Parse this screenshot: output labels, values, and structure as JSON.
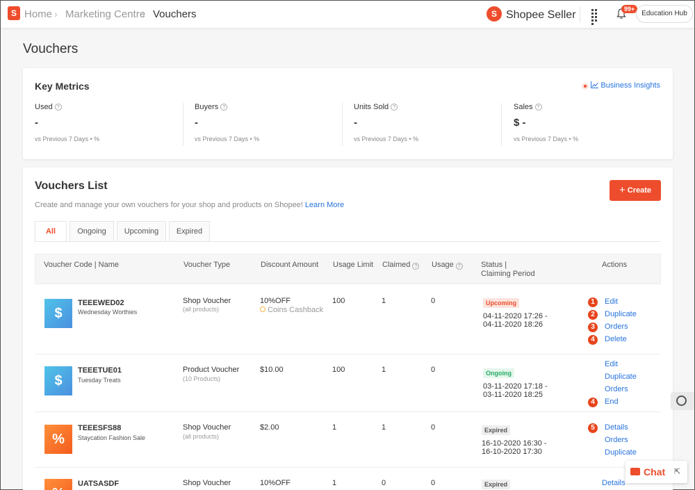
{
  "breadcrumb": {
    "home": "Home",
    "marketing": "Marketing Centre",
    "current": "Vouchers"
  },
  "header": {
    "brand": "Shopee Seller",
    "notif_badge": "99+",
    "education_hub": "Education Hub"
  },
  "page_title": "Vouchers",
  "key_metrics": {
    "title": "Key Metrics",
    "business_insights": "Business Insights",
    "metrics": [
      {
        "label": "Used",
        "value": "-",
        "compare": "vs Previous 7 Days • %"
      },
      {
        "label": "Buyers",
        "value": "-",
        "compare": "vs Previous 7 Days • %"
      },
      {
        "label": "Units Sold",
        "value": "-",
        "compare": "vs Previous 7 Days • %"
      },
      {
        "label": "Sales",
        "value": "$ -",
        "compare": "vs Previous 7 Days • %"
      }
    ]
  },
  "vouchers_list": {
    "title": "Vouchers List",
    "description": "Create and manage your own vouchers for your shop and products on Shopee!",
    "learn_more": "Learn More",
    "create_label": "Create",
    "tabs": [
      "All",
      "Ongoing",
      "Upcoming",
      "Expired"
    ],
    "columns": {
      "code_name": "Voucher Code | Name",
      "type": "Voucher Type",
      "discount": "Discount Amount",
      "usage_limit": "Usage Limit",
      "claimed": "Claimed",
      "usage": "Usage",
      "status_line1": "Status |",
      "status_line2": "Claiming Period",
      "actions": "Actions"
    },
    "rows": [
      {
        "code": "TEEEWED02",
        "name": "Wednesday Worthies",
        "thumb": "$",
        "type": "Shop Voucher",
        "type_sub": "(all products)",
        "discount": "10%OFF",
        "cashback": "Coins Cashback",
        "usage_limit": "100",
        "claimed": "1",
        "usage": "0",
        "status": "Upcoming",
        "period_start": "04-11-2020 17:26 -",
        "period_end": "04-11-2020 18:26",
        "actions": [
          "Edit",
          "Duplicate",
          "Orders",
          "Delete"
        ],
        "markers": [
          "1",
          "2",
          "3",
          "4"
        ]
      },
      {
        "code": "TEEETUE01",
        "name": "Tuesday Treats",
        "thumb": "$",
        "type": "Product Voucher",
        "type_sub": "(10 Products)",
        "discount": "$10.00",
        "usage_limit": "100",
        "claimed": "1",
        "usage": "0",
        "status": "Ongoing",
        "period_start": "03-11-2020 17:18 -",
        "period_end": "03-11-2020 18:25",
        "actions": [
          "Edit",
          "Duplicate",
          "Orders",
          "End"
        ],
        "markers": [
          "4"
        ]
      },
      {
        "code": "TEEESFS88",
        "name": "Staycation Fashion Sale",
        "thumb": "%",
        "type": "Shop Voucher",
        "type_sub": "(all products)",
        "discount": "$2.00",
        "usage_limit": "1",
        "claimed": "1",
        "usage": "0",
        "status": "Expired",
        "period_start": "16-10-2020 16:30 -",
        "period_end": "16-10-2020 17:30",
        "actions": [
          "Details",
          "Orders",
          "Duplicate"
        ],
        "markers": [
          "5"
        ]
      },
      {
        "code": "UATSASDF",
        "thumb": "%",
        "type": "Shop Voucher",
        "discount": "10%OFF",
        "usage_limit": "1",
        "claimed": "0",
        "usage": "0",
        "status": "Expired",
        "actions": [
          "Details"
        ]
      }
    ]
  },
  "chat": {
    "label": "Chat"
  },
  "colors": {
    "accent": "#ee4d2d",
    "link": "#2673dd",
    "ongoing": "#26aa63"
  }
}
